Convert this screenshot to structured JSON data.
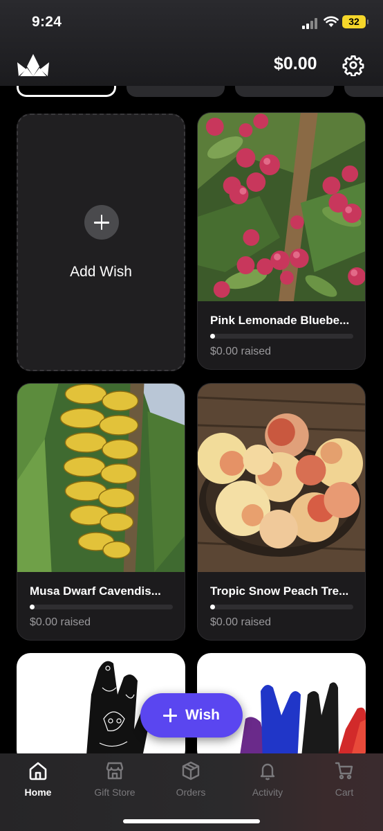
{
  "status_bar": {
    "time": "9:24",
    "battery": "32"
  },
  "header": {
    "balance": "$0.00",
    "logo_icon": "crown-logo-icon",
    "settings_icon": "gear-icon"
  },
  "add_wish": {
    "label": "Add Wish",
    "icon": "plus-icon"
  },
  "wishes": [
    {
      "title": "Pink Lemonade Bluebe...",
      "raised": "$0.00 raised",
      "progress": 0
    },
    {
      "title": "Musa Dwarf Cavendis...",
      "raised": "$0.00 raised",
      "progress": 0
    },
    {
      "title": "Tropic Snow Peach Tre...",
      "raised": "$0.00 raised",
      "progress": 0
    }
  ],
  "fab": {
    "label": "Wish",
    "icon": "plus-icon"
  },
  "tabs": [
    {
      "label": "Home",
      "icon": "home-icon",
      "active": true
    },
    {
      "label": "Gift Store",
      "icon": "store-icon",
      "active": false
    },
    {
      "label": "Orders",
      "icon": "box-icon",
      "active": false
    },
    {
      "label": "Activity",
      "icon": "bell-icon",
      "active": false
    },
    {
      "label": "Cart",
      "icon": "cart-icon",
      "active": false
    }
  ],
  "colors": {
    "accent": "#5a46f0",
    "background": "#000000",
    "card": "#1c1b1d"
  }
}
